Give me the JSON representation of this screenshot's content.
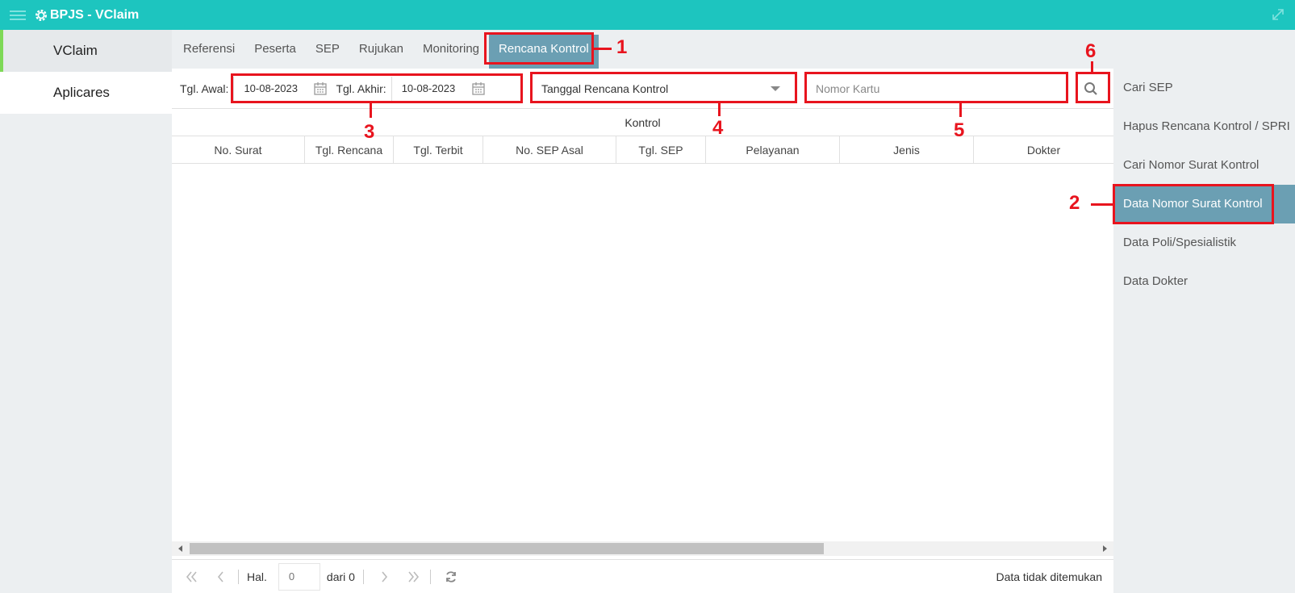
{
  "app": {
    "title": "BPJS - VClaim"
  },
  "leftnav": {
    "items": [
      {
        "label": "VClaim"
      },
      {
        "label": "Aplicares"
      }
    ]
  },
  "tabs": [
    {
      "label": "Referensi"
    },
    {
      "label": "Peserta"
    },
    {
      "label": "SEP"
    },
    {
      "label": "Rujukan"
    },
    {
      "label": "Monitoring"
    },
    {
      "label": "Rencana Kontrol"
    }
  ],
  "filter": {
    "start_label": "Tgl. Awal:",
    "start_value": "10-08-2023",
    "end_label": "Tgl. Akhir:",
    "end_value": "10-08-2023",
    "type_selected": "Tanggal Rencana Kontrol",
    "card_placeholder": "Nomor Kartu"
  },
  "table": {
    "group_header": "Kontrol",
    "columns": [
      "No. Surat",
      "Tgl. Rencana",
      "Tgl. Terbit",
      "No. SEP Asal",
      "Tgl. SEP",
      "Pelayanan",
      "Jenis",
      "Dokter"
    ],
    "rows": []
  },
  "pager": {
    "page_label": "Hal.",
    "page_value": "0",
    "of_label": "dari 0",
    "info": "Data tidak ditemukan"
  },
  "rightnav": {
    "items": [
      {
        "label": "Cari SEP"
      },
      {
        "label": "Hapus Rencana Kontrol / SPRI"
      },
      {
        "label": "Cari Nomor Surat Kontrol"
      },
      {
        "label": "Data Nomor Surat Kontrol"
      },
      {
        "label": "Data Poli/Spesialistik"
      },
      {
        "label": "Data Dokter"
      }
    ]
  },
  "annotations": [
    "1",
    "2",
    "3",
    "4",
    "5",
    "6"
  ],
  "colors": {
    "topbar": "#1dc5bf",
    "active": "#6b9fb3",
    "highlight": "#e8141e",
    "leftnav_accent": "#7ed957"
  }
}
